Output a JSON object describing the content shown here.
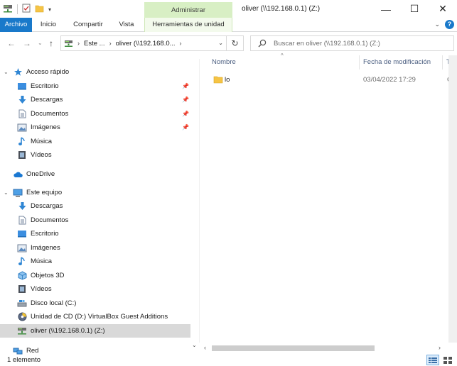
{
  "window": {
    "title": "oliver (\\\\192.168.0.1) (Z:)",
    "context_group": "Administrar",
    "controls": {
      "minimize": "—",
      "maximize": "☐",
      "close": "✕"
    }
  },
  "ribbon": {
    "tabs": [
      "Archivo",
      "Inicio",
      "Compartir",
      "Vista",
      "Herramientas de unidad"
    ],
    "help": "?"
  },
  "address": {
    "crumbs": [
      "Este ...",
      "oliver (\\\\192.168.0..."
    ],
    "search_placeholder": "Buscar en oliver (\\\\192.168.0.1) (Z:)"
  },
  "navpane": {
    "quick_access": {
      "label": "Acceso rápido",
      "items": [
        {
          "label": "Escritorio",
          "icon": "desktop-icon",
          "pinned": true
        },
        {
          "label": "Descargas",
          "icon": "download-icon",
          "pinned": true
        },
        {
          "label": "Documentos",
          "icon": "document-icon",
          "pinned": true
        },
        {
          "label": "Imágenes",
          "icon": "pictures-icon",
          "pinned": true
        },
        {
          "label": "Música",
          "icon": "music-icon",
          "pinned": false
        },
        {
          "label": "Vídeos",
          "icon": "video-icon",
          "pinned": false
        }
      ]
    },
    "onedrive": {
      "label": "OneDrive",
      "icon": "cloud-icon"
    },
    "this_pc": {
      "label": "Este equipo",
      "items": [
        {
          "label": "Descargas",
          "icon": "download-icon"
        },
        {
          "label": "Documentos",
          "icon": "document-icon"
        },
        {
          "label": "Escritorio",
          "icon": "desktop-icon"
        },
        {
          "label": "Imágenes",
          "icon": "pictures-icon"
        },
        {
          "label": "Música",
          "icon": "music-icon"
        },
        {
          "label": "Objetos 3D",
          "icon": "cube-icon"
        },
        {
          "label": "Vídeos",
          "icon": "video-icon"
        },
        {
          "label": "Disco local (C:)",
          "icon": "drive-icon"
        },
        {
          "label": "Unidad de CD (D:) VirtualBox Guest Additions",
          "icon": "cd-icon"
        },
        {
          "label": "oliver (\\\\192.168.0.1) (Z:)",
          "icon": "network-drive-icon",
          "selected": true
        }
      ]
    },
    "network": {
      "label": "Red",
      "icon": "network-icon"
    }
  },
  "content": {
    "columns": [
      "Nombre",
      "Fecha de modificación",
      "Tip"
    ],
    "files": [
      {
        "name": "lo",
        "modified": "03/04/2022 17:29",
        "type": "Ca"
      }
    ]
  },
  "status": {
    "count": "1 elemento"
  },
  "colors": {
    "file_tab": "#1979ca",
    "context_tab": "#d8efc4",
    "selection": "#d9d9d9",
    "folder": "#f6c445"
  }
}
